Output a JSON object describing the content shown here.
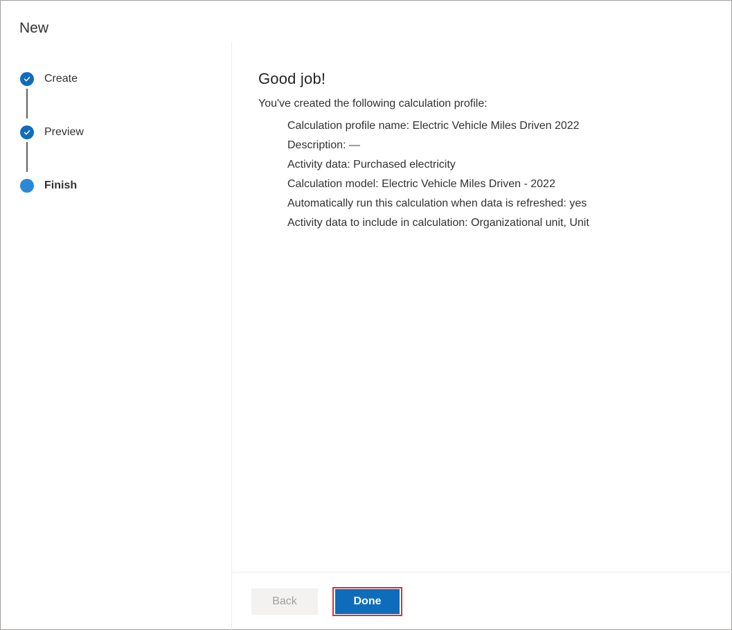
{
  "window": {
    "title": "New"
  },
  "stepper": {
    "steps": [
      {
        "label": "Create",
        "state": "completed"
      },
      {
        "label": "Preview",
        "state": "completed"
      },
      {
        "label": "Finish",
        "state": "current"
      }
    ]
  },
  "content": {
    "heading": "Good job!",
    "intro": "You've created the following calculation profile:",
    "details": [
      "Calculation profile name: Electric Vehicle Miles Driven 2022",
      "Description: —",
      "Activity data: Purchased electricity",
      "Calculation model: Electric Vehicle Miles Driven - 2022",
      "Automatically run this calculation when data is refreshed: yes",
      "Activity data to include in calculation: Organizational unit, Unit"
    ]
  },
  "footer": {
    "back_label": "Back",
    "done_label": "Done"
  },
  "colors": {
    "accent": "#0f6cbd",
    "current_step": "#2b88d8",
    "highlight": "#d13438"
  },
  "icons": {
    "completed_step": "checkmark-icon",
    "current_step": "filled-circle-icon"
  }
}
